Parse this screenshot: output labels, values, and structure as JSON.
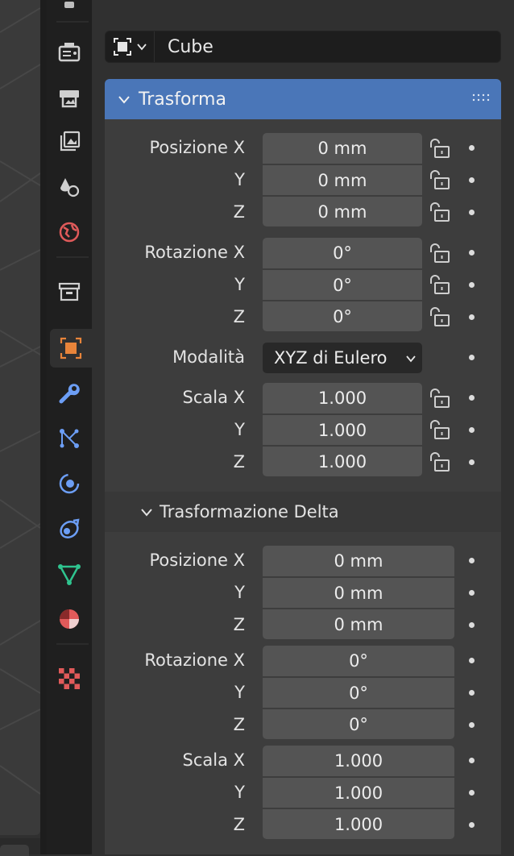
{
  "object_bar": {
    "type_icon": "object-icon",
    "name": "Cube"
  },
  "panel": {
    "title": "Trasforma"
  },
  "transform": {
    "location": {
      "label": "Posizione X",
      "axis_y": "Y",
      "axis_z": "Z",
      "x": "0 mm",
      "y": "0 mm",
      "z": "0 mm"
    },
    "rotation": {
      "label": "Rotazione X",
      "axis_y": "Y",
      "axis_z": "Z",
      "x": "0°",
      "y": "0°",
      "z": "0°"
    },
    "mode": {
      "label": "Modalità",
      "value": "XYZ di Eulero"
    },
    "scale": {
      "label": "Scala X",
      "axis_y": "Y",
      "axis_z": "Z",
      "x": "1.000",
      "y": "1.000",
      "z": "1.000"
    }
  },
  "delta": {
    "title": "Trasformazione Delta",
    "location": {
      "label": "Posizione X",
      "axis_y": "Y",
      "axis_z": "Z",
      "x": "0 mm",
      "y": "0 mm",
      "z": "0 mm"
    },
    "rotation": {
      "label": "Rotazione X",
      "axis_y": "Y",
      "axis_z": "Z",
      "x": "0°",
      "y": "0°",
      "z": "0°"
    },
    "scale": {
      "label": "Scala X",
      "axis_y": "Y",
      "axis_z": "Z",
      "x": "1.000",
      "y": "1.000",
      "z": "1.000"
    }
  },
  "tabs": [
    "tool",
    "render",
    "output",
    "view-layer",
    "scene",
    "world",
    "collection",
    "object",
    "modifiers",
    "particles",
    "physics",
    "constraints",
    "data",
    "material",
    "texture"
  ],
  "colors": {
    "accent": "#4a76b8",
    "object_orange": "#e8843a",
    "modifier_blue": "#6c9ef5",
    "mesh_green": "#2fc48f",
    "material_red": "#e05a5a"
  }
}
